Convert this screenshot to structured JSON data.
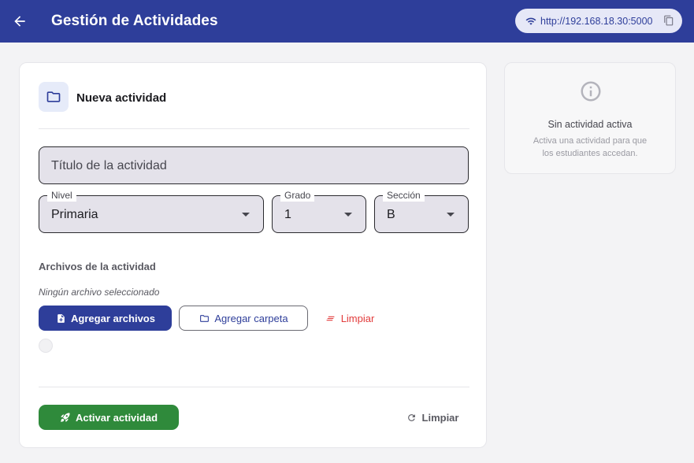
{
  "appbar": {
    "title": "Gestión de Actividades",
    "url": "http://192.168.18.30:5000",
    "icons": {
      "back": "arrow-left-icon",
      "wifi": "wifi-icon",
      "copy": "copy-icon"
    }
  },
  "activity_card": {
    "title": "Nueva actividad",
    "header_icon": "folder-icon",
    "title_field": {
      "placeholder": "Título de la actividad",
      "value": ""
    },
    "selects": {
      "nivel": {
        "label": "Nivel",
        "value": "Primaria"
      },
      "grado": {
        "label": "Grado",
        "value": "1"
      },
      "seccion": {
        "label": "Sección",
        "value": "B"
      }
    },
    "files": {
      "section_label": "Archivos de la actividad",
      "empty_text": "Ningún archivo seleccionado",
      "add_files_label": "Agregar archivos",
      "add_folder_label": "Agregar carpeta",
      "clear_label": "Limpiar"
    },
    "activate_label": "Activar actividad",
    "reset_label": "Limpiar"
  },
  "status_card": {
    "title": "Sin actividad activa",
    "subtitle": "Activa una actividad para que los estudiantes accedan.",
    "icon": "info-icon"
  },
  "colors": {
    "primary": "#2e3e9a",
    "success": "#2f8a3b",
    "danger": "#e23b3b",
    "field_bg": "#e4e2ea",
    "page_bg": "#f3f3f5"
  }
}
